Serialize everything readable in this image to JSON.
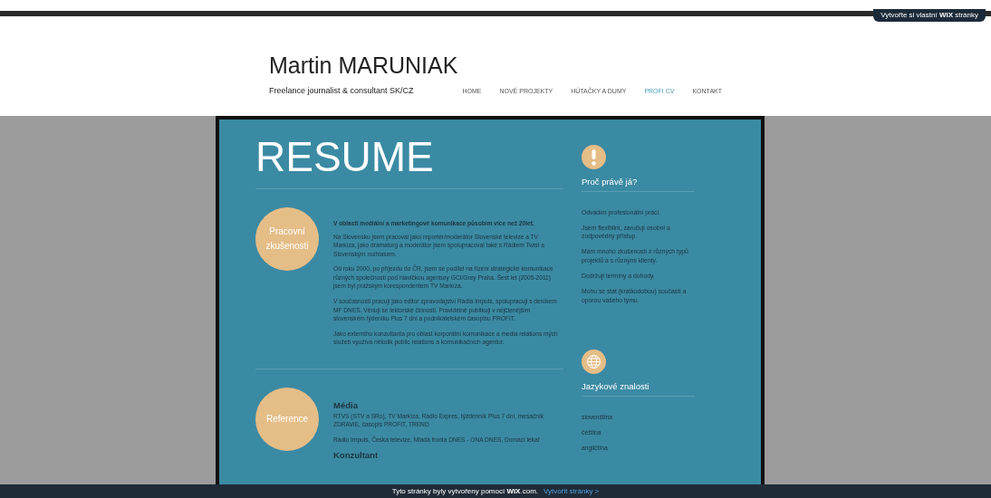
{
  "wix_badge": {
    "text": "Vytvořte si vlastní **WiX** stránky"
  },
  "header": {
    "name": "Martin MARUNIAK",
    "tagline": "Freelance journalist & consultant SK/CZ",
    "nav": [
      {
        "label": "HOME",
        "selected": false
      },
      {
        "label": "NOVÉ PROJEKTY",
        "selected": false
      },
      {
        "label": "HÚTAČKY A DUMY",
        "selected": false
      },
      {
        "label": "PROFI CV",
        "selected": true
      },
      {
        "label": "KONTAKT",
        "selected": false
      }
    ]
  },
  "resume": {
    "title": "RESUME",
    "sections": [
      {
        "badge": "Pracovní zkušenosti",
        "blocks": [
          {
            "lead": "V oblasti mediální a marketingové komunikace působím více než 20let.",
            "paragraphs": [
              "Na Slovensku jsem pracoval jako reportér/moderátor Slovenské televize a TV Markíza, jako dramaturg a moderátor jsem spolupracoval také s Rádiem Twist a Slovenským rozhlasem.",
              "Od roku 2000, po příjezdu do ČR, jsem se podílel na řízení strategické komunikace různých společností pod hlavičkou agentury GCI/Grey Praha. Šest let (2005-2011) jsem byl pražským korespondentem TV Markíza.",
              "V současnosti pracuji jako editor zpravodajství Rádia Impuls, spolupracuji s deníkem MF DNES. Věnuji se lektorské činnosti. Pravidelně publikuji v nejčtenějším slovenském týdeníku Plus 7 dní a podnikatelském časopisu PROFIT.",
              "Jako externího konzultanta pro oblast korporátní komunikace a media relations mých služeb využívá několik public relations a komunikačních agentur."
            ]
          }
        ]
      },
      {
        "badge": "Reference",
        "blocks": [
          {
            "heading": "Média",
            "paragraphs": [
              "RTVS (STV a SRo), TV Markíza, Rádio Expres, týždenník Plus 7 dní, mesačník ZDRAVIE, časopis PROFIT, TREND",
              "Rádio Impuls, Česká televize, Mladá fronta DNES - ONA DNES, Domácí lékař"
            ]
          },
          {
            "heading": "Konzultant"
          }
        ]
      }
    ]
  },
  "sidebar": [
    {
      "kind": "exclamation",
      "title": "Proč právě já?",
      "items": [
        "Odvádím profesionální práci.",
        "Jsem flexibilní, zaručuji osobní a zodpovědný přístup.",
        "Mám mnoho zkušeností z různých typů projektů a s různými klienty.",
        "Dodržuji termíny a dohody.",
        "Mohu se stát (krátkodobou) součástí a oporou vašeho týmu."
      ]
    },
    {
      "kind": "globe",
      "title": "Jazykové znalosti",
      "items": [
        "slovenština",
        "čeština",
        "angličtina"
      ]
    }
  ],
  "footer_bar": {
    "text": "Tyto stránky byly vytvořeny pomocí **WiX**.com.",
    "link": "Vytvořit stránky >"
  }
}
